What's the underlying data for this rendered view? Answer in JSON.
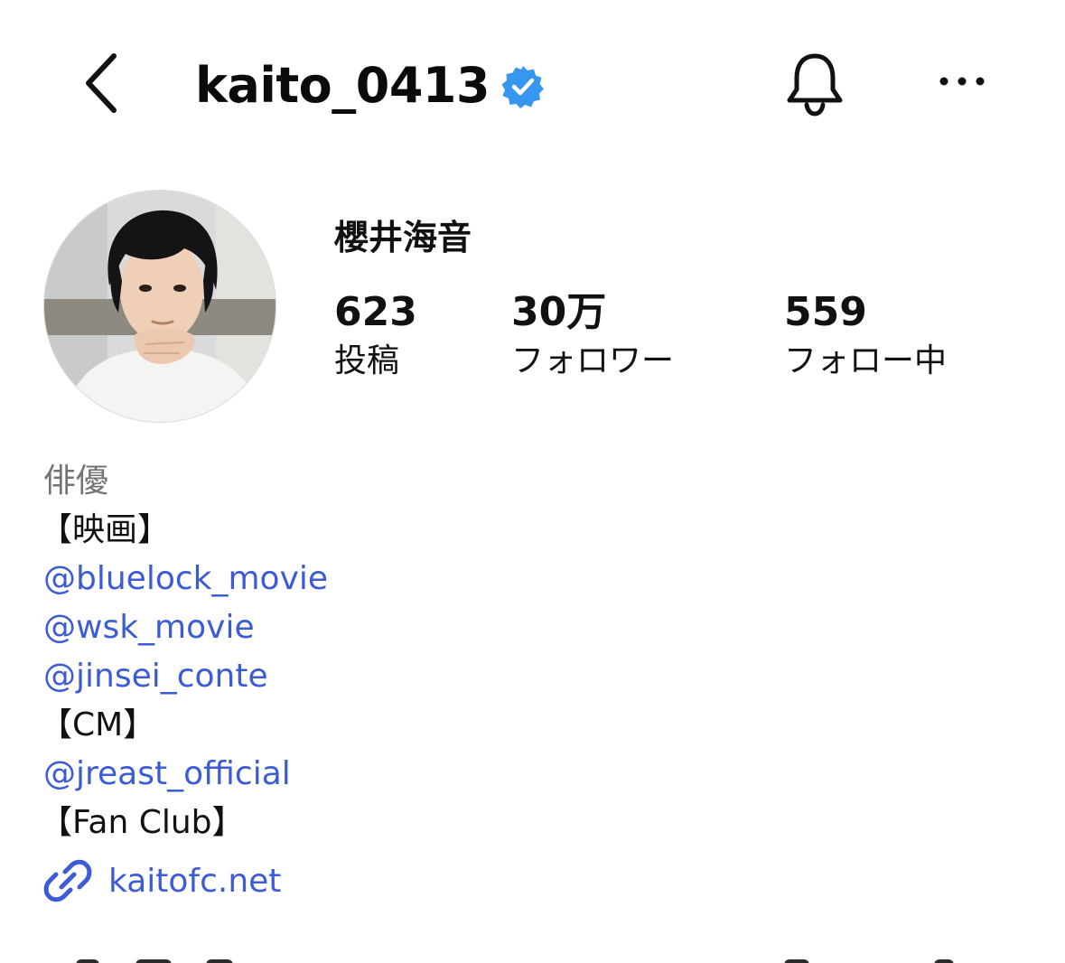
{
  "header": {
    "username": "kaito_0413",
    "back_icon": "chevron-left-icon",
    "verified_icon": "verified-badge-icon",
    "verified_color": "#3797f0",
    "notification_icon": "bell-icon",
    "more_icon": "more-horizontal-icon"
  },
  "profile": {
    "display_name": "櫻井海音",
    "avatar": "profile-photo"
  },
  "stats": {
    "posts": {
      "value": "623",
      "label": "投稿"
    },
    "followers": {
      "value": "30万",
      "label": "フォロワー"
    },
    "following": {
      "value": "559",
      "label": "フォロー中"
    }
  },
  "bio": {
    "category": "俳優",
    "lines": [
      {
        "type": "text",
        "text": "【映画】"
      },
      {
        "type": "mention",
        "text": "@bluelock_movie"
      },
      {
        "type": "mention",
        "text": "@wsk_movie"
      },
      {
        "type": "mention",
        "text": "@jinsei_conte"
      },
      {
        "type": "text",
        "text": "【CM】"
      },
      {
        "type": "mention",
        "text": "@jreast_official"
      },
      {
        "type": "text",
        "text": "【Fan Club】"
      }
    ],
    "link": {
      "icon": "link-icon",
      "text": "kaitofc.net"
    }
  },
  "colors": {
    "link_blue": "#3c5bd6",
    "category_gray": "#737373",
    "text": "#111111"
  }
}
